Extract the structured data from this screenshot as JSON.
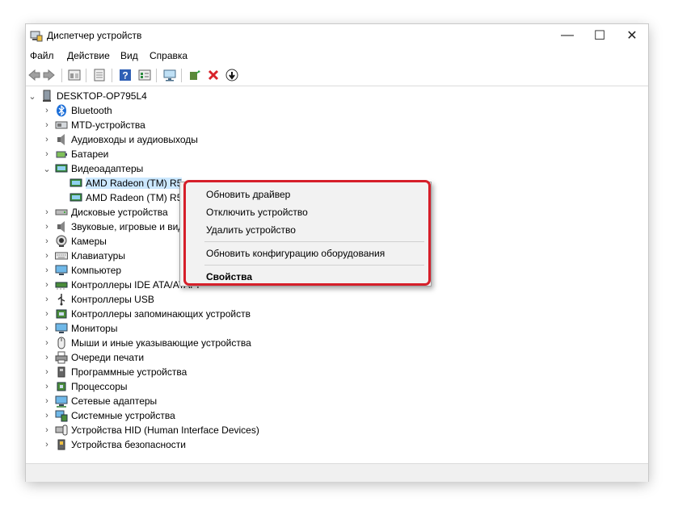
{
  "window": {
    "title": "Диспетчер устройств",
    "controls": {
      "minimize": "—",
      "maximize": "☐",
      "close": "✕"
    }
  },
  "menu": [
    "Файл",
    "Действие",
    "Вид",
    "Справка"
  ],
  "toolbar_icons": [
    "back-icon",
    "forward-icon",
    "show-hidden-icon",
    "properties-icon",
    "help-icon",
    "view-icon",
    "scan-hardware-icon",
    "update-driver-icon",
    "uninstall-icon",
    "disable-icon"
  ],
  "tree": {
    "root": "DESKTOP-OP795L4",
    "items": [
      "Bluetooth",
      "MTD-устройства",
      "Аудиовходы и аудиовыходы",
      "Батареи",
      "Видеоадаптеры",
      "AMD Radeon (TM) R5",
      "AMD Radeon (TM) R5",
      "Дисковые устройства",
      "Звуковые, игровые и видеоустройства",
      "Камеры",
      "Клавиатуры",
      "Компьютер",
      "Контроллеры IDE ATA/ATAPI",
      "Контроллеры USB",
      "Контроллеры запоминающих устройств",
      "Мониторы",
      "Мыши и иные указывающие устройства",
      "Очереди печати",
      "Программные устройства",
      "Процессоры",
      "Сетевые адаптеры",
      "Системные устройства",
      "Устройства HID (Human Interface Devices)",
      "Устройства безопасности"
    ]
  },
  "context_menu": {
    "update_driver": "Обновить драйвер",
    "disable_device": "Отключить устройство",
    "uninstall_device": "Удалить устройство",
    "scan_hardware": "Обновить конфигурацию оборудования",
    "properties": "Свойства"
  },
  "colors": {
    "highlight": "#d61f2a",
    "selection": "#cce8ff",
    "close_x": "#d8232a"
  }
}
